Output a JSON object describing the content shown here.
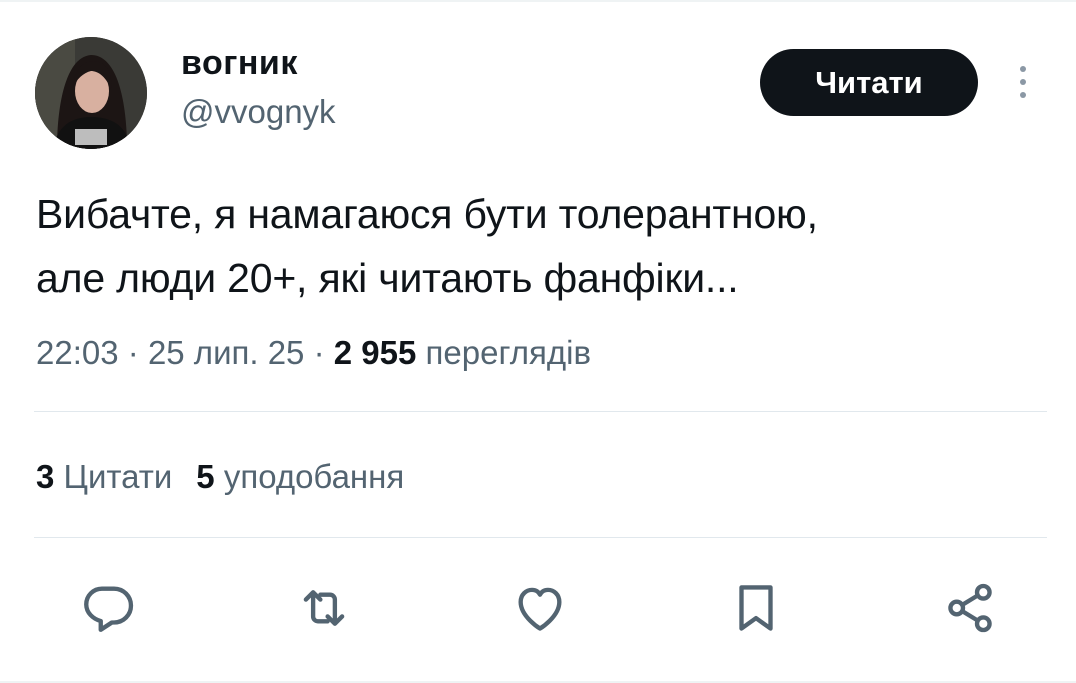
{
  "user": {
    "display_name": "вогник",
    "handle": "@vvognyk",
    "avatar_icon": "avatar-photo"
  },
  "follow_button": {
    "label": "Читати"
  },
  "more_button": {
    "icon": "more-vertical-icon"
  },
  "tweet": {
    "text_line_1": "Вибачте, я намагаюся бути толерантною,",
    "text_line_2": "але люди 20+, які читають фанфіки..."
  },
  "meta": {
    "time": "22:03",
    "separator": "·",
    "date": "25 лип. 25",
    "views_count": "2 955",
    "views_label": "переглядів"
  },
  "stats": {
    "quotes_count": "3",
    "quotes_label": "Цитати",
    "likes_count": "5",
    "likes_label": "уподобання"
  },
  "actions": [
    {
      "name": "reply",
      "icon": "reply-icon"
    },
    {
      "name": "retweet",
      "icon": "retweet-icon"
    },
    {
      "name": "like",
      "icon": "heart-icon"
    },
    {
      "name": "bookmark",
      "icon": "bookmark-icon"
    },
    {
      "name": "share",
      "icon": "share-icon"
    }
  ],
  "colors": {
    "text": "#0f1419",
    "secondary": "#536471",
    "button_bg": "#0f1419",
    "button_text": "#ffffff",
    "divider": "#e1e8ed"
  }
}
